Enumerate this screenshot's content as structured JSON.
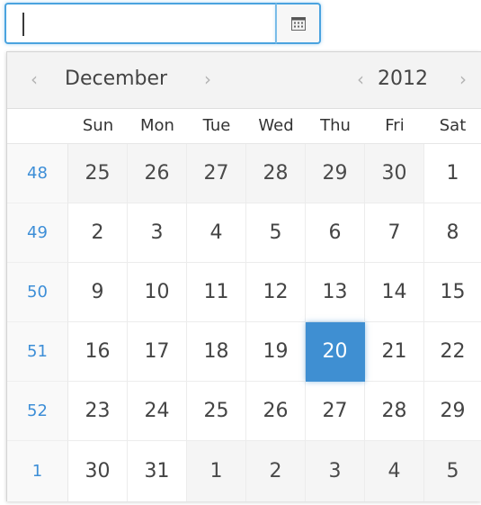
{
  "input": {
    "value": "",
    "placeholder": ""
  },
  "button": {
    "icon": "calendar-icon"
  },
  "header": {
    "month": "December",
    "year": "2012",
    "prev_month_symbol": "‹",
    "next_month_symbol": "›",
    "prev_year_symbol": "‹",
    "next_year_symbol": "›"
  },
  "weekdays": [
    "Sun",
    "Mon",
    "Tue",
    "Wed",
    "Thu",
    "Fri",
    "Sat"
  ],
  "weeks": [
    {
      "week_number": "48",
      "days": [
        "25",
        "26",
        "27",
        "28",
        "29",
        "30",
        "1"
      ]
    },
    {
      "week_number": "49",
      "days": [
        "2",
        "3",
        "4",
        "5",
        "6",
        "7",
        "8"
      ]
    },
    {
      "week_number": "50",
      "days": [
        "9",
        "10",
        "11",
        "12",
        "13",
        "14",
        "15"
      ]
    },
    {
      "week_number": "51",
      "days": [
        "16",
        "17",
        "18",
        "19",
        "20",
        "21",
        "22"
      ]
    },
    {
      "week_number": "52",
      "days": [
        "23",
        "24",
        "25",
        "26",
        "27",
        "28",
        "29"
      ]
    },
    {
      "week_number": "1",
      "days": [
        "30",
        "31",
        "1",
        "2",
        "3",
        "4",
        "5"
      ]
    }
  ],
  "selected_date": "20",
  "colors": {
    "accent": "#4aa3df",
    "selected": "#3f8fd2",
    "week_number": "#3d8ed7",
    "header_bg": "#f3f3f3",
    "other_month_bg": "#f5f5f5"
  }
}
